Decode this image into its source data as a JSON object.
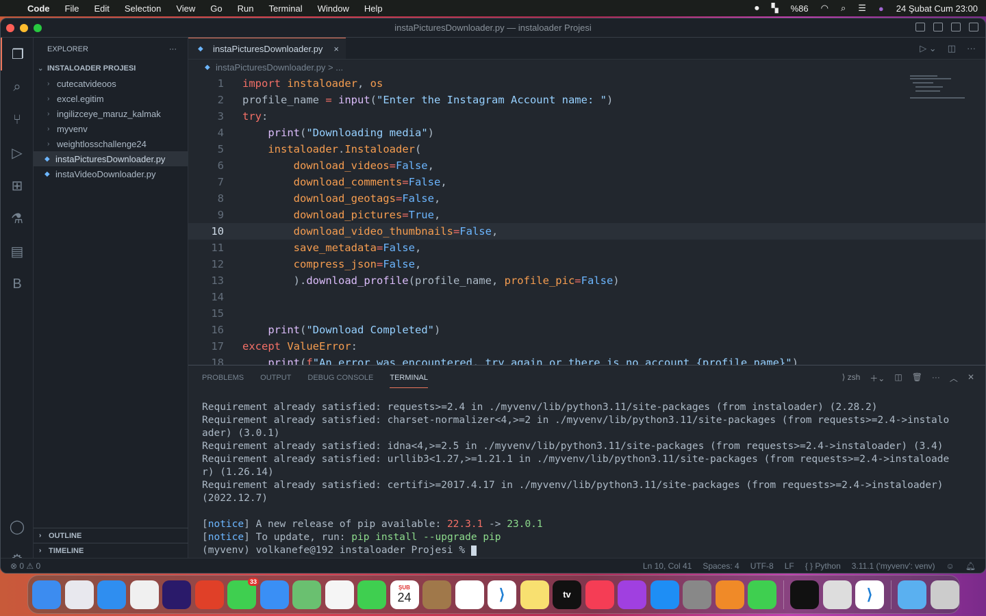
{
  "menubar": {
    "apple": "",
    "items": [
      "Code",
      "File",
      "Edit",
      "Selection",
      "View",
      "Go",
      "Run",
      "Terminal",
      "Window",
      "Help"
    ],
    "battery": "%86",
    "datetime": "24 Şubat Cum  23:00"
  },
  "window": {
    "title": "instaPicturesDownloader.py — instaloader Projesi"
  },
  "explorer": {
    "header": "EXPLORER",
    "more": "···",
    "project": "INSTALOADER PROJESI",
    "folders": [
      "cutecatvideoos",
      "excel.egitim",
      "ingilizceye_maruz_kalmak",
      "myvenv",
      "weightlosschallenge24"
    ],
    "files": [
      "instaPicturesDownloader.py",
      "instaVideoDownloader.py"
    ],
    "outline": "OUTLINE",
    "timeline": "TIMELINE"
  },
  "editor": {
    "tab": "instaPicturesDownloader.py",
    "close": "×",
    "breadcrumb": "instaPicturesDownloader.py > ...",
    "current_line": 10,
    "lines": [
      [
        [
          "import ",
          "kw"
        ],
        [
          "instaloader",
          "id"
        ],
        [
          ", ",
          "pl"
        ],
        [
          "os",
          "id"
        ]
      ],
      [
        [
          "profile_name ",
          "pl"
        ],
        [
          "= ",
          "kw"
        ],
        [
          "input",
          "fn"
        ],
        [
          "(",
          "pl"
        ],
        [
          "\"Enter the Instagram Account name: \"",
          "st"
        ],
        [
          ")",
          "pl"
        ]
      ],
      [
        [
          "try",
          "kw"
        ],
        [
          ":",
          "pl"
        ]
      ],
      [
        [
          "    print",
          "fn"
        ],
        [
          "(",
          "pl"
        ],
        [
          "\"Downloading media\"",
          "st"
        ],
        [
          ")",
          "pl"
        ]
      ],
      [
        [
          "    instaloader",
          "id"
        ],
        [
          ".",
          "pl"
        ],
        [
          "Instaloader",
          "id"
        ],
        [
          "(",
          "pl"
        ]
      ],
      [
        [
          "        download_videos",
          "pa"
        ],
        [
          "=",
          "kw"
        ],
        [
          "False",
          "bl"
        ],
        [
          ",",
          "pl"
        ]
      ],
      [
        [
          "        download_comments",
          "pa"
        ],
        [
          "=",
          "kw"
        ],
        [
          "False",
          "bl"
        ],
        [
          ",",
          "pl"
        ]
      ],
      [
        [
          "        download_geotags",
          "pa"
        ],
        [
          "=",
          "kw"
        ],
        [
          "False",
          "bl"
        ],
        [
          ",",
          "pl"
        ]
      ],
      [
        [
          "        download_pictures",
          "pa"
        ],
        [
          "=",
          "kw"
        ],
        [
          "True",
          "bl"
        ],
        [
          ",",
          "pl"
        ]
      ],
      [
        [
          "        download_video_thumbnails",
          "pa"
        ],
        [
          "=",
          "kw"
        ],
        [
          "False",
          "bl"
        ],
        [
          ",",
          "pl"
        ]
      ],
      [
        [
          "        save_metadata",
          "pa"
        ],
        [
          "=",
          "kw"
        ],
        [
          "False",
          "bl"
        ],
        [
          ",",
          "pl"
        ]
      ],
      [
        [
          "        compress_json",
          "pa"
        ],
        [
          "=",
          "kw"
        ],
        [
          "False",
          "bl"
        ],
        [
          ",",
          "pl"
        ]
      ],
      [
        [
          "        ).",
          "pl"
        ],
        [
          "download_profile",
          "fn"
        ],
        [
          "(profile_name, ",
          "pl"
        ],
        [
          "profile_pic",
          "pa"
        ],
        [
          "=",
          "kw"
        ],
        [
          "False",
          "bl"
        ],
        [
          ")",
          "pl"
        ]
      ],
      [],
      [],
      [
        [
          "    print",
          "fn"
        ],
        [
          "(",
          "pl"
        ],
        [
          "\"Download Completed\"",
          "st"
        ],
        [
          ")",
          "pl"
        ]
      ],
      [
        [
          "except ",
          "kw"
        ],
        [
          "ValueError",
          "id"
        ],
        [
          ":",
          "pl"
        ]
      ],
      [
        [
          "    print",
          "fn"
        ],
        [
          "(",
          "pl"
        ],
        [
          "f",
          "kw"
        ],
        [
          "\"An error was encountered, try again or there is no account {profile_name}\"",
          "st"
        ],
        [
          ")",
          "pl"
        ]
      ]
    ]
  },
  "panel": {
    "tabs": [
      "PROBLEMS",
      "OUTPUT",
      "DEBUG CONSOLE",
      "TERMINAL"
    ],
    "shell": "zsh",
    "lines": [
      [
        [
          "Requirement already satisfied: requests>=2.4 in ./myvenv/lib/python3.11/site-packages (from instaloader) (2.28.2)",
          "pl"
        ]
      ],
      [
        [
          "Requirement already satisfied: charset-normalizer<4,>=2 in ./myvenv/lib/python3.11/site-packages (from requests>=2.4->instalo",
          "pl"
        ]
      ],
      [
        [
          "ader) (3.0.1)",
          "pl"
        ]
      ],
      [
        [
          "Requirement already satisfied: idna<4,>=2.5 in ./myvenv/lib/python3.11/site-packages (from requests>=2.4->instaloader) (3.4)",
          "pl"
        ]
      ],
      [
        [
          "Requirement already satisfied: urllib3<1.27,>=1.21.1 in ./myvenv/lib/python3.11/site-packages (from requests>=2.4->instaloade",
          "pl"
        ]
      ],
      [
        [
          "r) (1.26.14)",
          "pl"
        ]
      ],
      [
        [
          "Requirement already satisfied: certifi>=2017.4.17 in ./myvenv/lib/python3.11/site-packages (from requests>=2.4->instaloader)",
          "pl"
        ]
      ],
      [
        [
          "(2022.12.7)",
          "pl"
        ]
      ],
      [],
      [
        [
          "[",
          "pl"
        ],
        [
          "notice",
          "bl"
        ],
        [
          "] A new release of pip available: ",
          "pl"
        ],
        [
          "22.3.1",
          "kw"
        ],
        [
          " -> ",
          "pl"
        ],
        [
          "23.0.1",
          "gr"
        ]
      ],
      [
        [
          "[",
          "pl"
        ],
        [
          "notice",
          "bl"
        ],
        [
          "] To update, run: ",
          "pl"
        ],
        [
          "pip install --upgrade pip",
          "gr"
        ]
      ]
    ],
    "prompt": "(myvenv) volkanefe@192 instaloader Projesi % "
  },
  "status": {
    "errors": "⊗ 0",
    "warnings": "⚠ 0",
    "position": "Ln 10, Col 41",
    "spaces": "Spaces: 4",
    "encoding": "UTF-8",
    "eol": "LF",
    "language": "{ } Python",
    "interpreter": "3.11.1 ('myvenv': venv)"
  },
  "dock": {
    "calendar_month": "ŞUB",
    "calendar_day": "24",
    "messages_badge": "33",
    "tv": "tv"
  },
  "colors": {
    "accent": "#ec775c",
    "bg": "#22272e",
    "sidebar": "#1c2128"
  }
}
